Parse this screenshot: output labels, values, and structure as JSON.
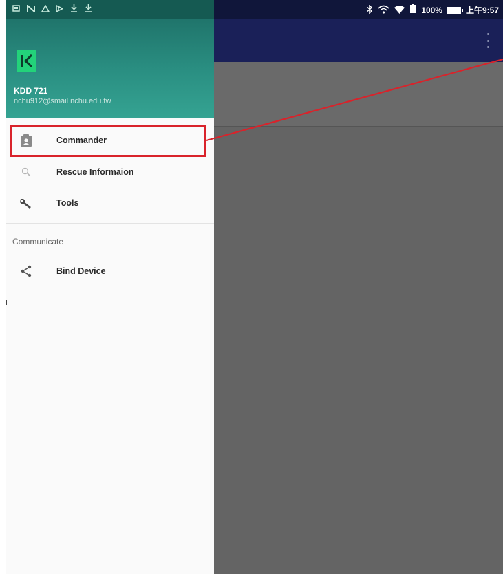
{
  "status_bar": {
    "left_icons": [
      "notification-icon",
      "n-app-icon",
      "warning-icon",
      "media-icon",
      "download-icon",
      "download-icon"
    ],
    "right": {
      "icons": [
        "bluetooth-icon",
        "wifi-calling-icon",
        "wifi-icon",
        "battery-icon"
      ],
      "battery_text": "100%",
      "time": "上午9:57"
    }
  },
  "drawer": {
    "header": {
      "logo_letter": "K",
      "user_name": "KDD 721",
      "email": "nchu912@smail.nchu.edu.tw"
    },
    "items": [
      {
        "label": "Commander",
        "icon": "clipboard-person-icon",
        "highlighted": true
      },
      {
        "label": "Rescue Informaion",
        "icon": "search-icon"
      },
      {
        "label": "Tools",
        "icon": "wrench-icon"
      }
    ],
    "section": {
      "title": "Communicate",
      "items": [
        {
          "label": "Bind Device",
          "icon": "share-icon"
        }
      ]
    }
  },
  "colors": {
    "header_green": "#2a8f82",
    "toolbar_navy": "#1a2058",
    "highlight_red": "#d9232b",
    "scrim_gray": "#646464",
    "logo_green": "#23d37a"
  }
}
